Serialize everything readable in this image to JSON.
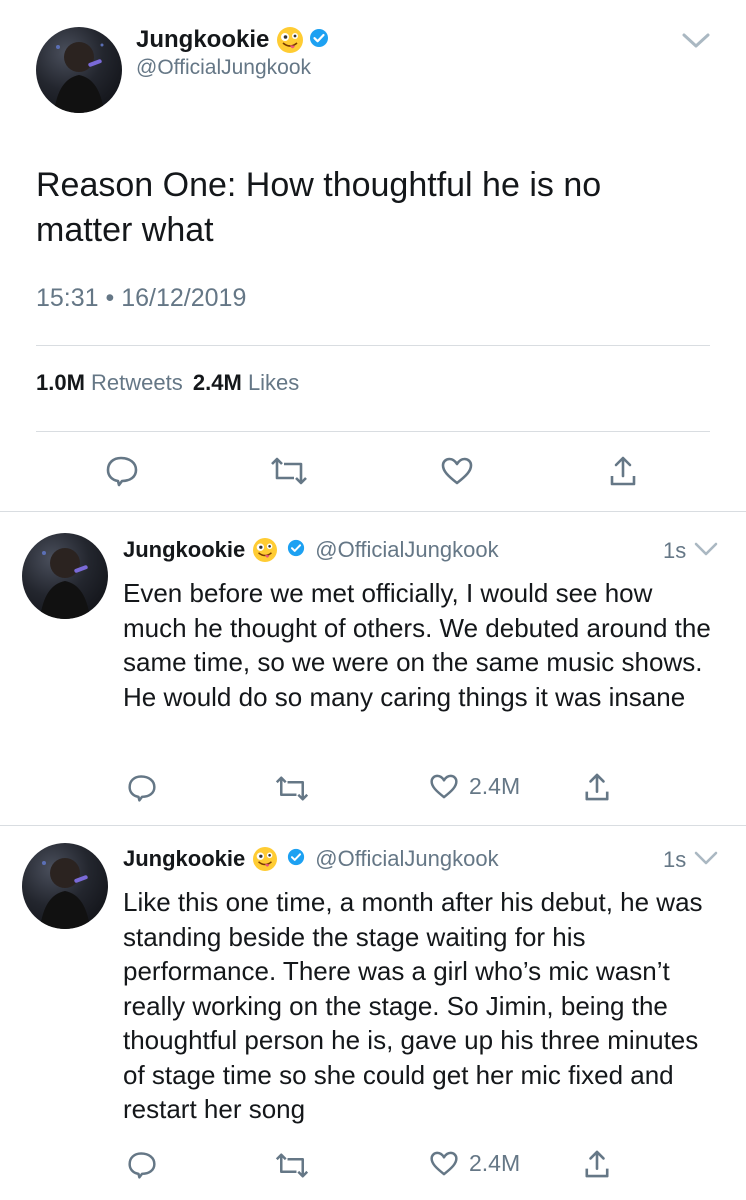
{
  "main_tweet": {
    "display_name": "Jungkookie",
    "handle": "@OfficialJungkook",
    "text": "Reason One: How thoughtful he is no matter what",
    "time": "15:31",
    "separator": "•",
    "date": "16/12/2019",
    "retweet_count": "1.0M",
    "retweets_label": "Retweets",
    "like_count": "2.4M",
    "likes_label": "Likes"
  },
  "replies": [
    {
      "display_name": "Jungkookie",
      "handle": "@OfficialJungkook",
      "age": "1s",
      "text": "Even before we met officially, I would see how much he thought of others. We debuted around the same time, so we were on the same music shows. He would do so many caring things it was insane",
      "like_count": "2.4M"
    },
    {
      "display_name": "Jungkookie",
      "handle": "@OfficialJungkook",
      "age": "1s",
      "text": "Like this one time, a month after his debut, he was standing beside the stage waiting for his performance. There was a girl who’s mic wasn’t really working on the stage. So Jimin, being the thoughtful person he is, gave up his three minutes of stage time so she could get her mic fixed and restart her song",
      "like_count": "2.4M"
    }
  ],
  "colors": {
    "verified": "#1da1f2",
    "text": "#14171a",
    "gray": "#657786",
    "divider": "#d9dde1",
    "emoji": "#ffcc33"
  },
  "icons": [
    "reply-icon",
    "retweet-icon",
    "like-icon",
    "share-icon",
    "chevron-down-icon",
    "verified-badge-icon",
    "zany-face-emoji-icon"
  ]
}
